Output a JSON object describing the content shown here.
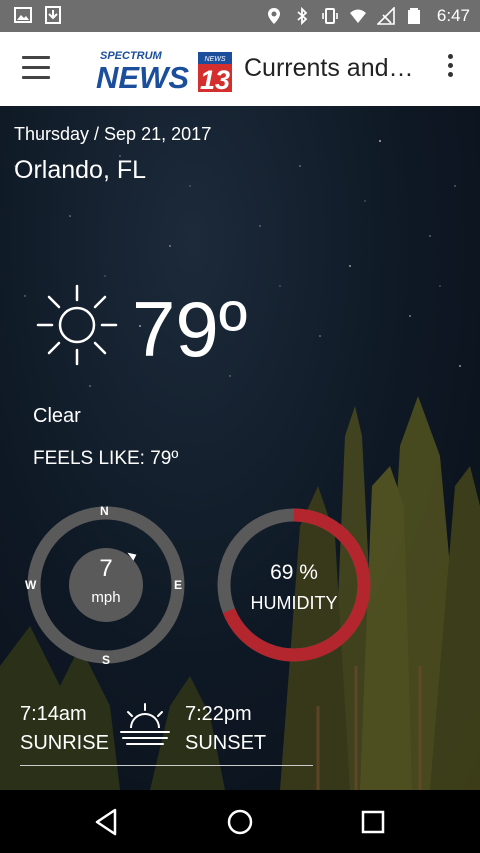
{
  "status_bar": {
    "time": "6:47",
    "icons": [
      "image-icon",
      "download-icon",
      "location-icon",
      "bluetooth-icon",
      "vibrate-icon",
      "wifi-icon",
      "no-signal-icon",
      "battery-icon"
    ]
  },
  "app_bar": {
    "logo_text_top": "SPECTRUM",
    "logo_text_main": "NEWS",
    "logo_badge": "13",
    "logo_badge_small": "NEWS",
    "title": "Currents and…"
  },
  "weather": {
    "date": "Thursday / Sep 21, 2017",
    "location": "Orlando, FL",
    "temperature": "79º",
    "condition": "Clear",
    "feels_like": "FEELS LIKE: 79º",
    "condition_icon": "sun-icon"
  },
  "wind": {
    "speed": "7",
    "unit": "mph",
    "compass": {
      "n": "N",
      "e": "E",
      "s": "S",
      "w": "W"
    },
    "direction_degrees": 45
  },
  "humidity": {
    "value": "69 %",
    "label": "HUMIDITY",
    "percent": 69,
    "colors": {
      "track": "#5a5a5a",
      "fill": "#b3262e"
    }
  },
  "sun": {
    "sunrise_time": "7:14am",
    "sunrise_label": "SUNRISE",
    "sunset_time": "7:22pm",
    "sunset_label": "SUNSET"
  },
  "nav": {
    "icons": [
      "back-icon",
      "home-icon",
      "recents-icon"
    ]
  },
  "colors": {
    "logo_blue": "#1b4f9c",
    "logo_red": "#d32f2f",
    "gauge_track": "#5a5a5a"
  }
}
